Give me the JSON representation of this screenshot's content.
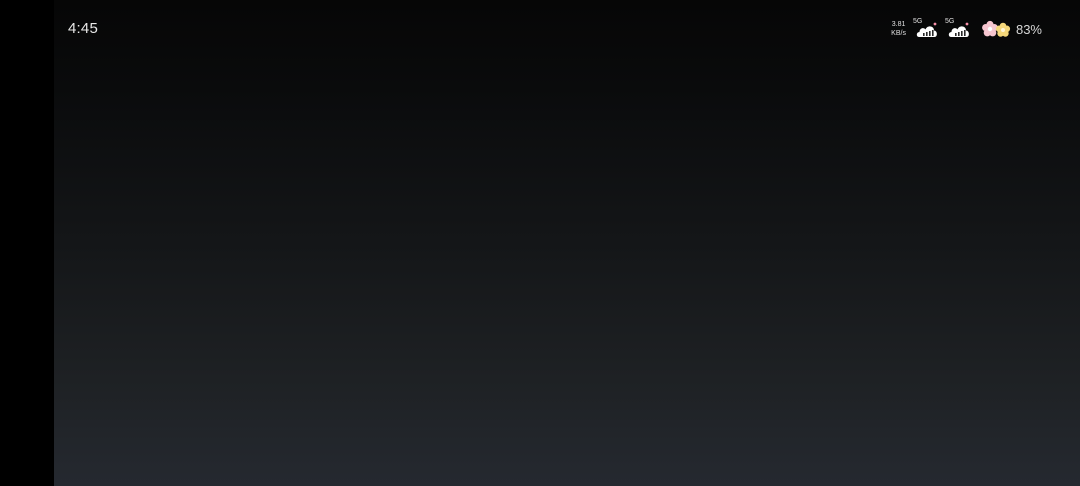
{
  "status_bar": {
    "time": "4:45",
    "network_speed": {
      "value": "3.81",
      "unit": "KB/s"
    },
    "sim1": {
      "tag": "5G",
      "icon": "cloud-signal-icon"
    },
    "sim2": {
      "tag": "5G",
      "icon": "cloud-signal-icon"
    },
    "battery": {
      "icon": "flower-battery-icon",
      "percent": "83%"
    }
  },
  "colors": {
    "background_top": "#060606",
    "background_bottom": "#252930",
    "status_text": "#e8e8e8",
    "flower_pink": "#f7c6d0",
    "flower_yellow": "#f5d77a"
  }
}
